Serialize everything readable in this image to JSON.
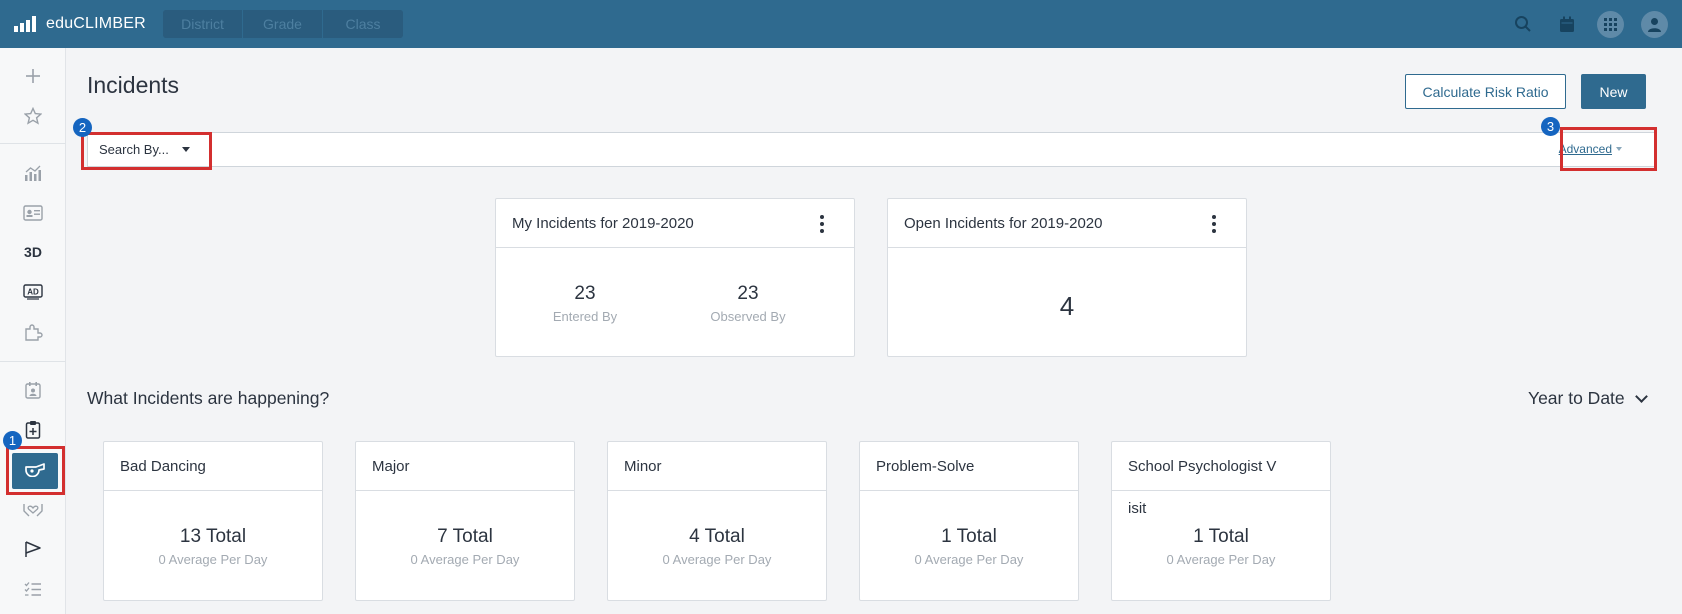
{
  "app": {
    "name": "eduCLIMBER",
    "context_tabs": [
      "District",
      "Grade",
      "Class"
    ]
  },
  "colors": {
    "brand": "#2f6a8f",
    "annotation_box": "#d32f2f",
    "annotation_badge": "#1565c0"
  },
  "topbar": {
    "icons": [
      "search-icon",
      "calendar-icon",
      "apps-grid-icon",
      "user-avatar-icon"
    ]
  },
  "sidebar": {
    "items": [
      {
        "name": "plus-icon"
      },
      {
        "name": "star-icon"
      },
      {
        "name": "analytics-chart-icon"
      },
      {
        "name": "student-id-card-icon"
      },
      {
        "name": "3d-label",
        "label": "3D"
      },
      {
        "name": "ad-badge-icon"
      },
      {
        "name": "puzzle-piece-icon"
      },
      {
        "name": "calendar-person-icon"
      },
      {
        "name": "clipboard-plus-icon"
      },
      {
        "name": "incidents-whistle-icon",
        "active": true
      },
      {
        "name": "hands-heart-icon"
      },
      {
        "name": "flag-icon"
      },
      {
        "name": "checklist-icon"
      }
    ]
  },
  "annotations": {
    "badge_1": "1",
    "badge_2": "2",
    "badge_3": "3"
  },
  "page": {
    "title": "Incidents",
    "calculate_label": "Calculate Risk Ratio",
    "new_label": "New"
  },
  "search": {
    "search_by_label": "Search By...",
    "advanced_label": "Advanced"
  },
  "summary_cards": {
    "my": {
      "title": "My Incidents for 2019-2020",
      "entered_value": "23",
      "entered_label": "Entered By",
      "observed_value": "23",
      "observed_label": "Observed By"
    },
    "open": {
      "title": "Open Incidents for 2019-2020",
      "value": "4"
    }
  },
  "section": {
    "title": "What Incidents are happening?",
    "range_label": "Year to Date"
  },
  "incident_types": [
    {
      "title": "Bad Dancing",
      "extra": "",
      "total": "13 Total",
      "avg": "0 Average Per Day"
    },
    {
      "title": "Major",
      "extra": "",
      "total": "7 Total",
      "avg": "0 Average Per Day"
    },
    {
      "title": "Minor",
      "extra": "",
      "total": "4 Total",
      "avg": "0 Average Per Day"
    },
    {
      "title": "Problem-Solve",
      "extra": "",
      "total": "1 Total",
      "avg": "0 Average Per Day"
    },
    {
      "title": "School Psychologist V",
      "extra": "isit",
      "total": "1 Total",
      "avg": "0 Average Per Day"
    }
  ]
}
